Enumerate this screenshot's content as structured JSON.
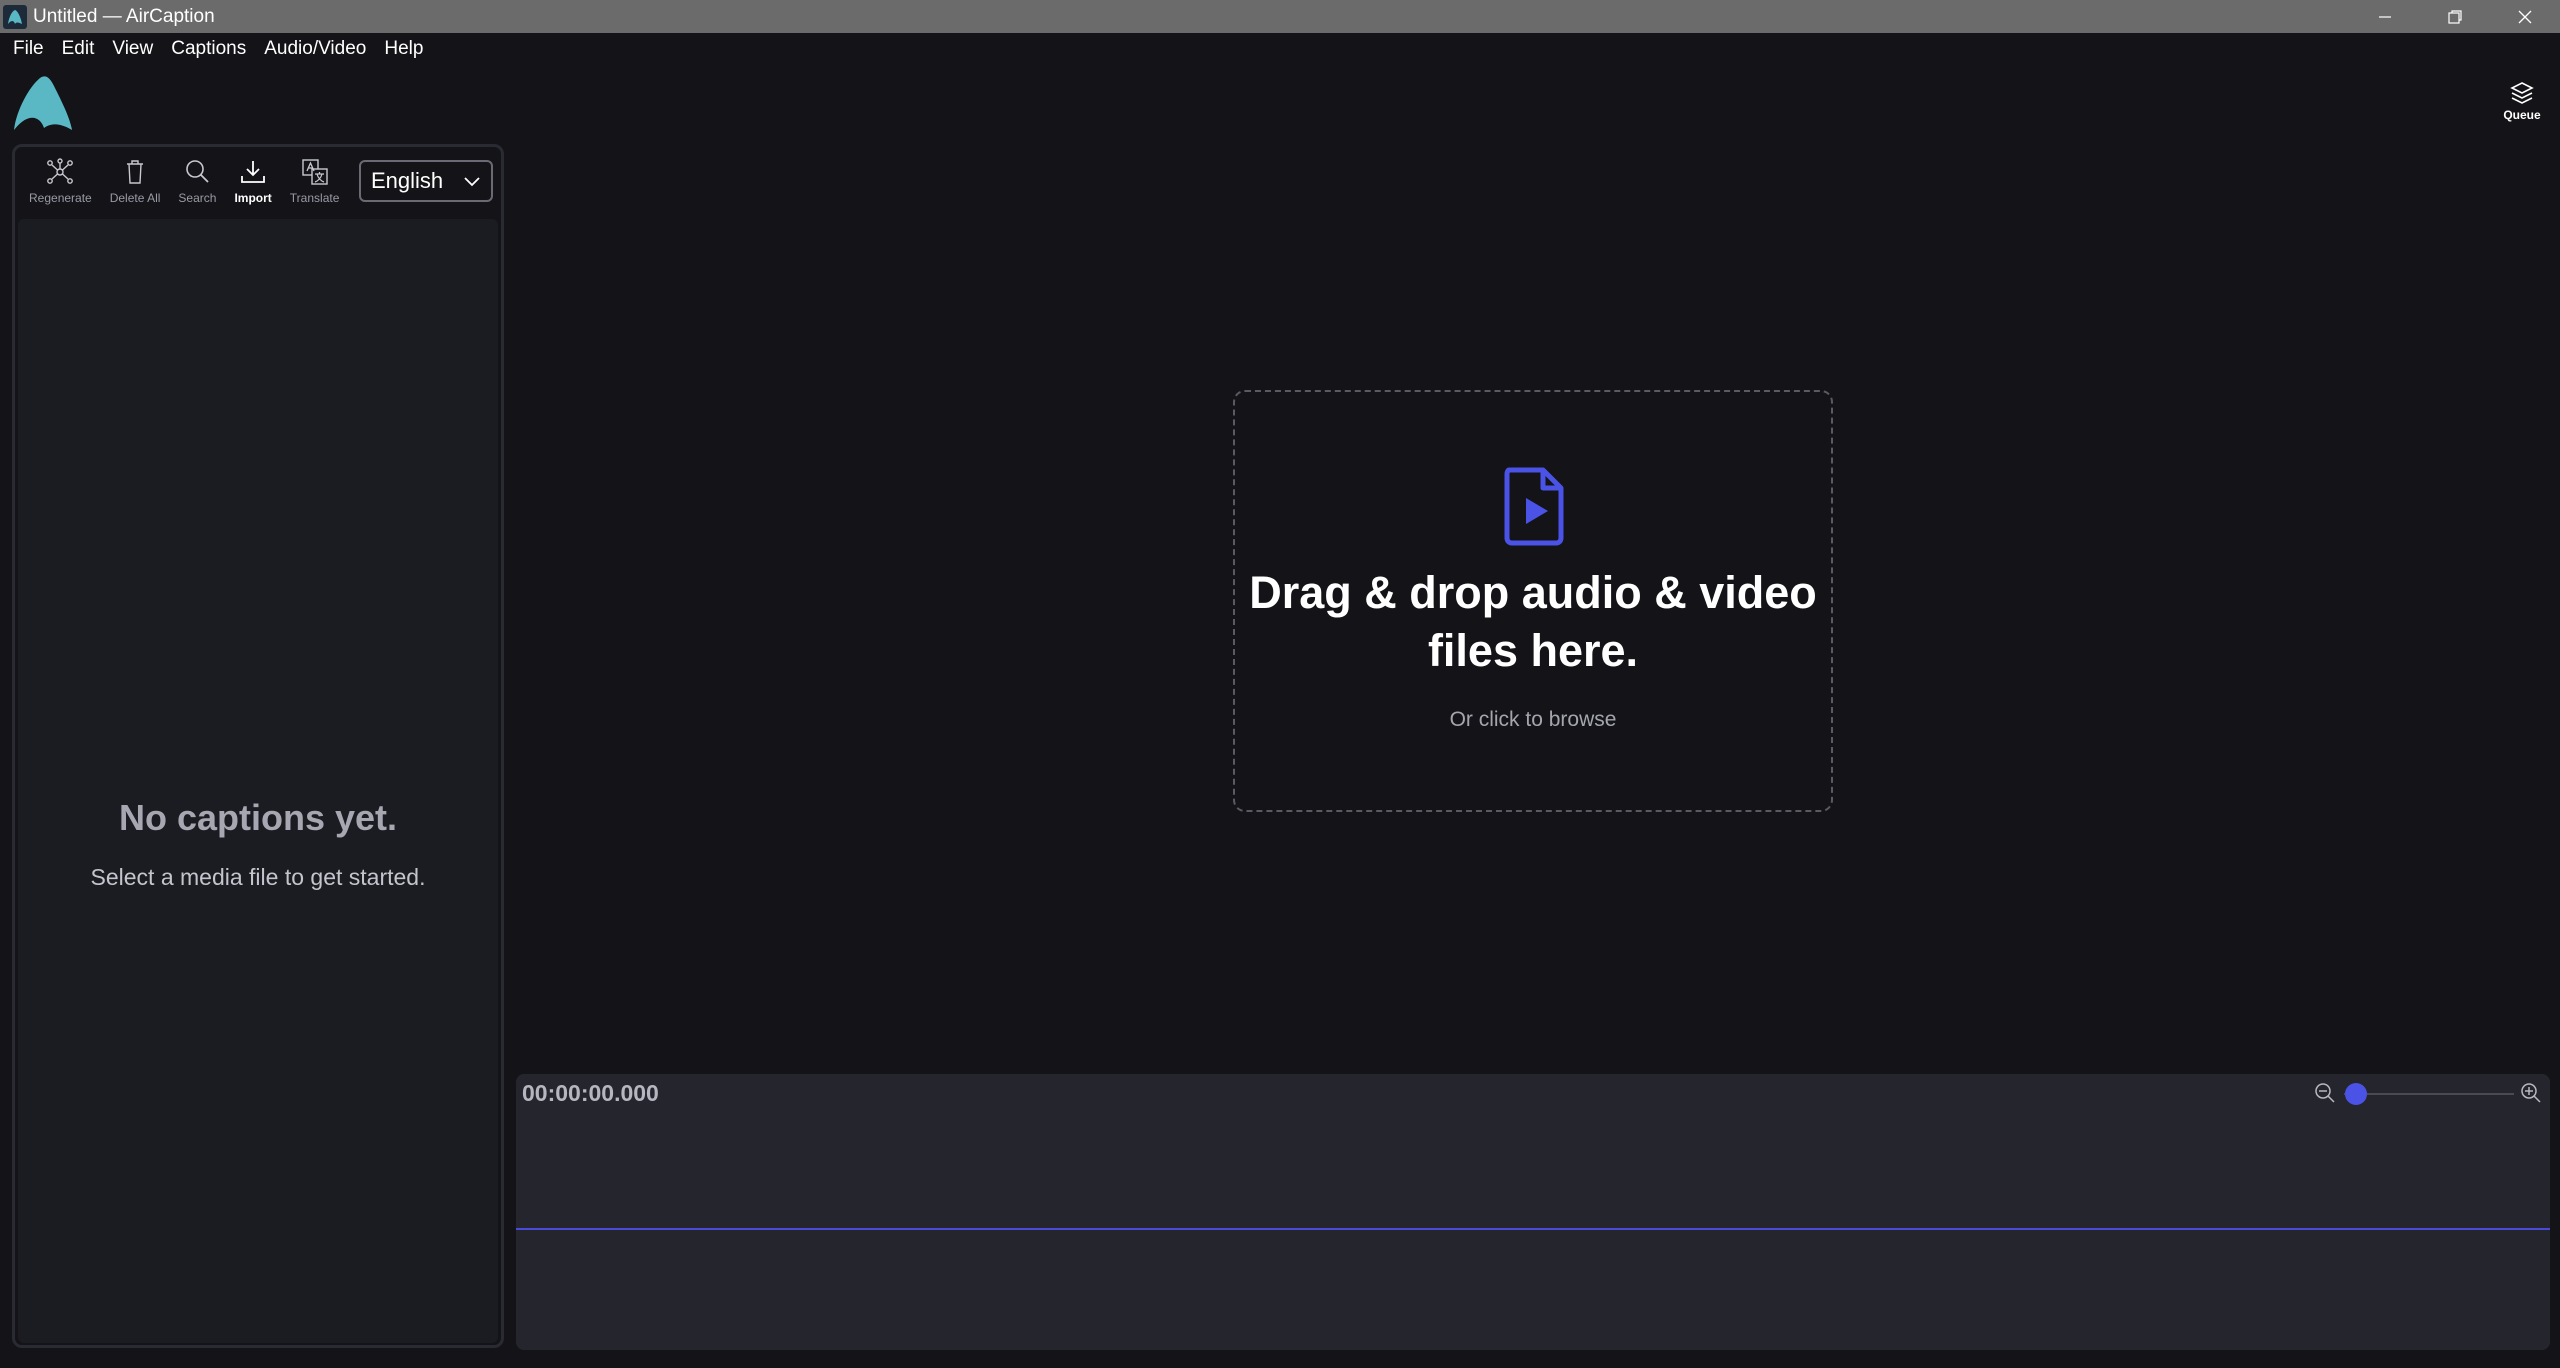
{
  "window": {
    "title": "Untitled — AirCaption"
  },
  "menu": {
    "items": [
      "File",
      "Edit",
      "View",
      "Captions",
      "Audio/Video",
      "Help"
    ]
  },
  "queue": {
    "label": "Queue"
  },
  "toolbar": {
    "regenerate": "Regenerate",
    "delete_all": "Delete All",
    "search": "Search",
    "import": "Import",
    "translate": "Translate",
    "language": "English"
  },
  "captions": {
    "empty_title": "No captions yet.",
    "empty_subtitle": "Select a media file to get started."
  },
  "dropzone": {
    "title": "Drag & drop audio & video files here.",
    "subtitle": "Or click to browse"
  },
  "timeline": {
    "timecode": "00:00:00.000",
    "zoom_level": 0.05
  },
  "colors": {
    "accent": "#4b53e6",
    "logo": "#5ab8c4",
    "background": "#131318",
    "panel": "#1b1b22",
    "timeline": "#25252d"
  },
  "icons": {
    "app": "aircaption-logo-icon",
    "regenerate": "nodes-icon",
    "delete_all": "trash-icon",
    "search": "search-icon",
    "import": "download-icon",
    "translate": "translate-icon",
    "queue": "layers-icon",
    "file": "video-file-icon"
  }
}
